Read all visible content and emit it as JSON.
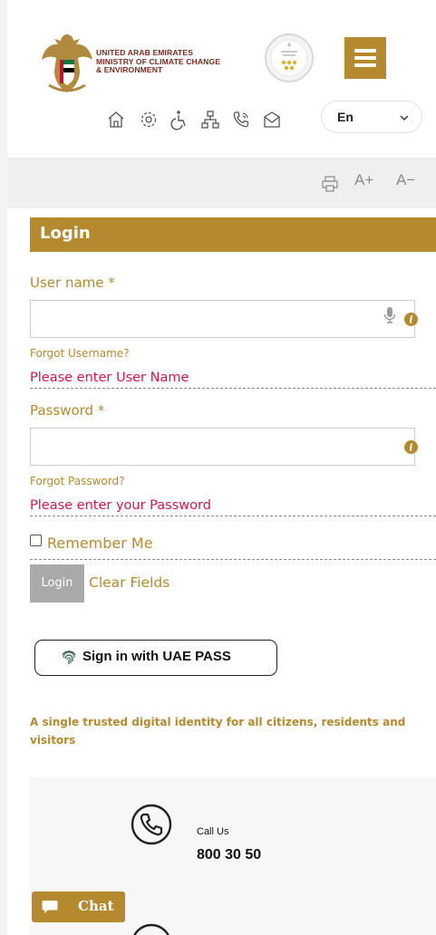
{
  "header": {
    "ministry_lines": [
      "UNITED ARAB EMIRATES",
      "MINISTRY OF CLIMATE CHANGE",
      "& ENVIRONMENT"
    ],
    "language_selected": "En"
  },
  "accessibility": {
    "increase_text": "A+",
    "decrease_text": "A−"
  },
  "login": {
    "title": "Login",
    "username_label": "User name *",
    "username_value": "",
    "forgot_username": "Forgot Username?",
    "username_error": "Please enter User Name",
    "password_label": "Password *",
    "password_value": "",
    "forgot_password": "Forgot Password?",
    "password_error": "Please enter your Password",
    "remember_me": "Remember Me",
    "login_button": "Login",
    "clear_button": "Clear Fields"
  },
  "uaepass": {
    "button_label": "Sign in with UAE PASS",
    "tagline": "A single trusted digital identity for all citizens, residents and visitors"
  },
  "contact": {
    "call_label": "Call Us",
    "call_number": "800 30 50"
  },
  "chat": {
    "label": "Chat"
  },
  "colors": {
    "brand_gold": "#b58a2f",
    "error_red": "#d6144a",
    "ministry_text": "#7a2a1d",
    "accessibility_bar": "#efefef"
  },
  "icons": [
    "emblem-icon",
    "seal-icon",
    "hamburger-menu-icon",
    "home-icon",
    "settings-icon",
    "accessibility-icon",
    "sitemap-icon",
    "phone-icon",
    "mail-icon",
    "chevron-down-icon",
    "print-icon",
    "microphone-icon",
    "info-icon",
    "fingerprint-icon",
    "chat-bubble-icon"
  ]
}
